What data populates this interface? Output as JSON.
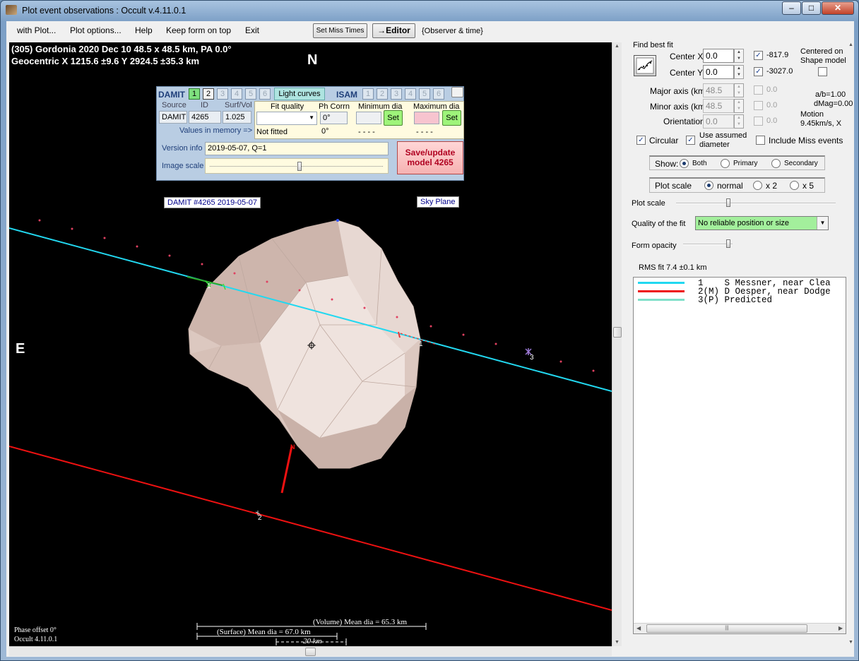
{
  "window": {
    "title": "Plot event observations : Occult v.4.11.0.1",
    "min": "–",
    "max": "□",
    "close": "✕"
  },
  "menu": {
    "with_plot": "with Plot...",
    "plot_options": "Plot options...",
    "help": "Help",
    "keep_on_top": "Keep form on top",
    "exit": "Exit",
    "set_miss_times": "Set Miss Times",
    "editor": "→Editor",
    "observer_time": "{Observer & time}"
  },
  "plot": {
    "header_line1": "(305) Gordonia  2020 Dec 10  48.5 x 48.5 km,  PA 0.0°",
    "header_line2": "Geocentric  X  1215.6 ±9.6  Y 2924.5 ±35.3 km",
    "north": "N",
    "east": "E",
    "damit_label": "DAMIT #4265 2019-05-07",
    "sky_plane": "Sky Plane",
    "chord1_label": "1",
    "chord1_label_b": "1",
    "chord2_label": "2",
    "pred_label": "3",
    "north_pole_label": "N",
    "phase_offset": "Phase offset 0°",
    "version": "Occult 4.11.0.1",
    "volume_mean": "(Volume) Mean dia = 65.3 km",
    "surface_mean": "(Surface) Mean dia = 67.0 km",
    "scale_20km": "20 km"
  },
  "shape_panel": {
    "damit": "DAMIT",
    "damit_nums": [
      "1",
      "2",
      "3",
      "4",
      "5",
      "6"
    ],
    "light_curves": "Light curves",
    "isam": "ISAM",
    "isam_nums": [
      "1",
      "2",
      "3",
      "4",
      "5",
      "6"
    ],
    "source_h": "Source",
    "id_h": "ID",
    "surfvol_h": "Surf/Vol",
    "source": "DAMIT",
    "id": "4265",
    "surfvol": "1.025",
    "fit_quality_h": "Fit quality",
    "ph_corr_h": "Ph Corrn",
    "min_dia_h": "Minimum dia",
    "max_dia_h": "Maximum dia",
    "ph_corr_val": "0°",
    "set": "Set",
    "values_mem": "Values in memory =>",
    "not_fitted": "Not fitted",
    "ph_corr_mem": "0°",
    "min_mem": "- - - -",
    "max_mem": "- - - -",
    "version_info_l": "Version info",
    "version_info": "2019-05-07, Q=1",
    "image_scale": "Image scale",
    "save_line1": "Save/update",
    "save_line2": "model 4265"
  },
  "right": {
    "find_best_fit": "Find best fit",
    "center_x_l": "Center X",
    "center_x": "0.0",
    "center_y_l": "Center Y",
    "center_y": "0.0",
    "cx_check_val": "-817.9",
    "cy_check_val": "-3027.0",
    "centered_on": "Centered on",
    "shape_model": "Shape model",
    "major_l": "Major axis (km)",
    "major": "48.5",
    "minor_l": "Minor axis (km)",
    "minor": "48.5",
    "orient_l": "Orientation",
    "orient": "0.0",
    "major_chk": "0.0",
    "minor_chk": "0.0",
    "orient_chk": "0.0",
    "ab": "a/b=1.00",
    "dmag": "dMag=0.00",
    "motion": "Motion",
    "motion_val": "9.45km/s, X",
    "circular": "Circular",
    "use_assumed": "Use assumed",
    "diameter": "diameter",
    "include_miss": "Include Miss events",
    "show": "Show:",
    "both": "Both",
    "primary": "Primary",
    "secondary": "Secondary",
    "plot_scale_g": "Plot scale",
    "normal": "normal",
    "x2": "x 2",
    "x5": "x 5",
    "plot_scale_l": "Plot scale",
    "quality_l": "Quality of the fit",
    "quality": "No reliable position or size",
    "form_opacity": "Form opacity",
    "rms": "RMS fit 7.4 ±0.1 km"
  },
  "legend": [
    {
      "num": "1",
      "tag": "   ",
      "name": "S Messner, near Clea",
      "color": "#22d8f0"
    },
    {
      "num": "2",
      "tag": "(M)",
      "name": "D Oesper, near Dodge",
      "color": "#ee1111"
    },
    {
      "num": "3",
      "tag": "(P)",
      "name": "Predicted",
      "color": "#7fe0c8"
    }
  ]
}
